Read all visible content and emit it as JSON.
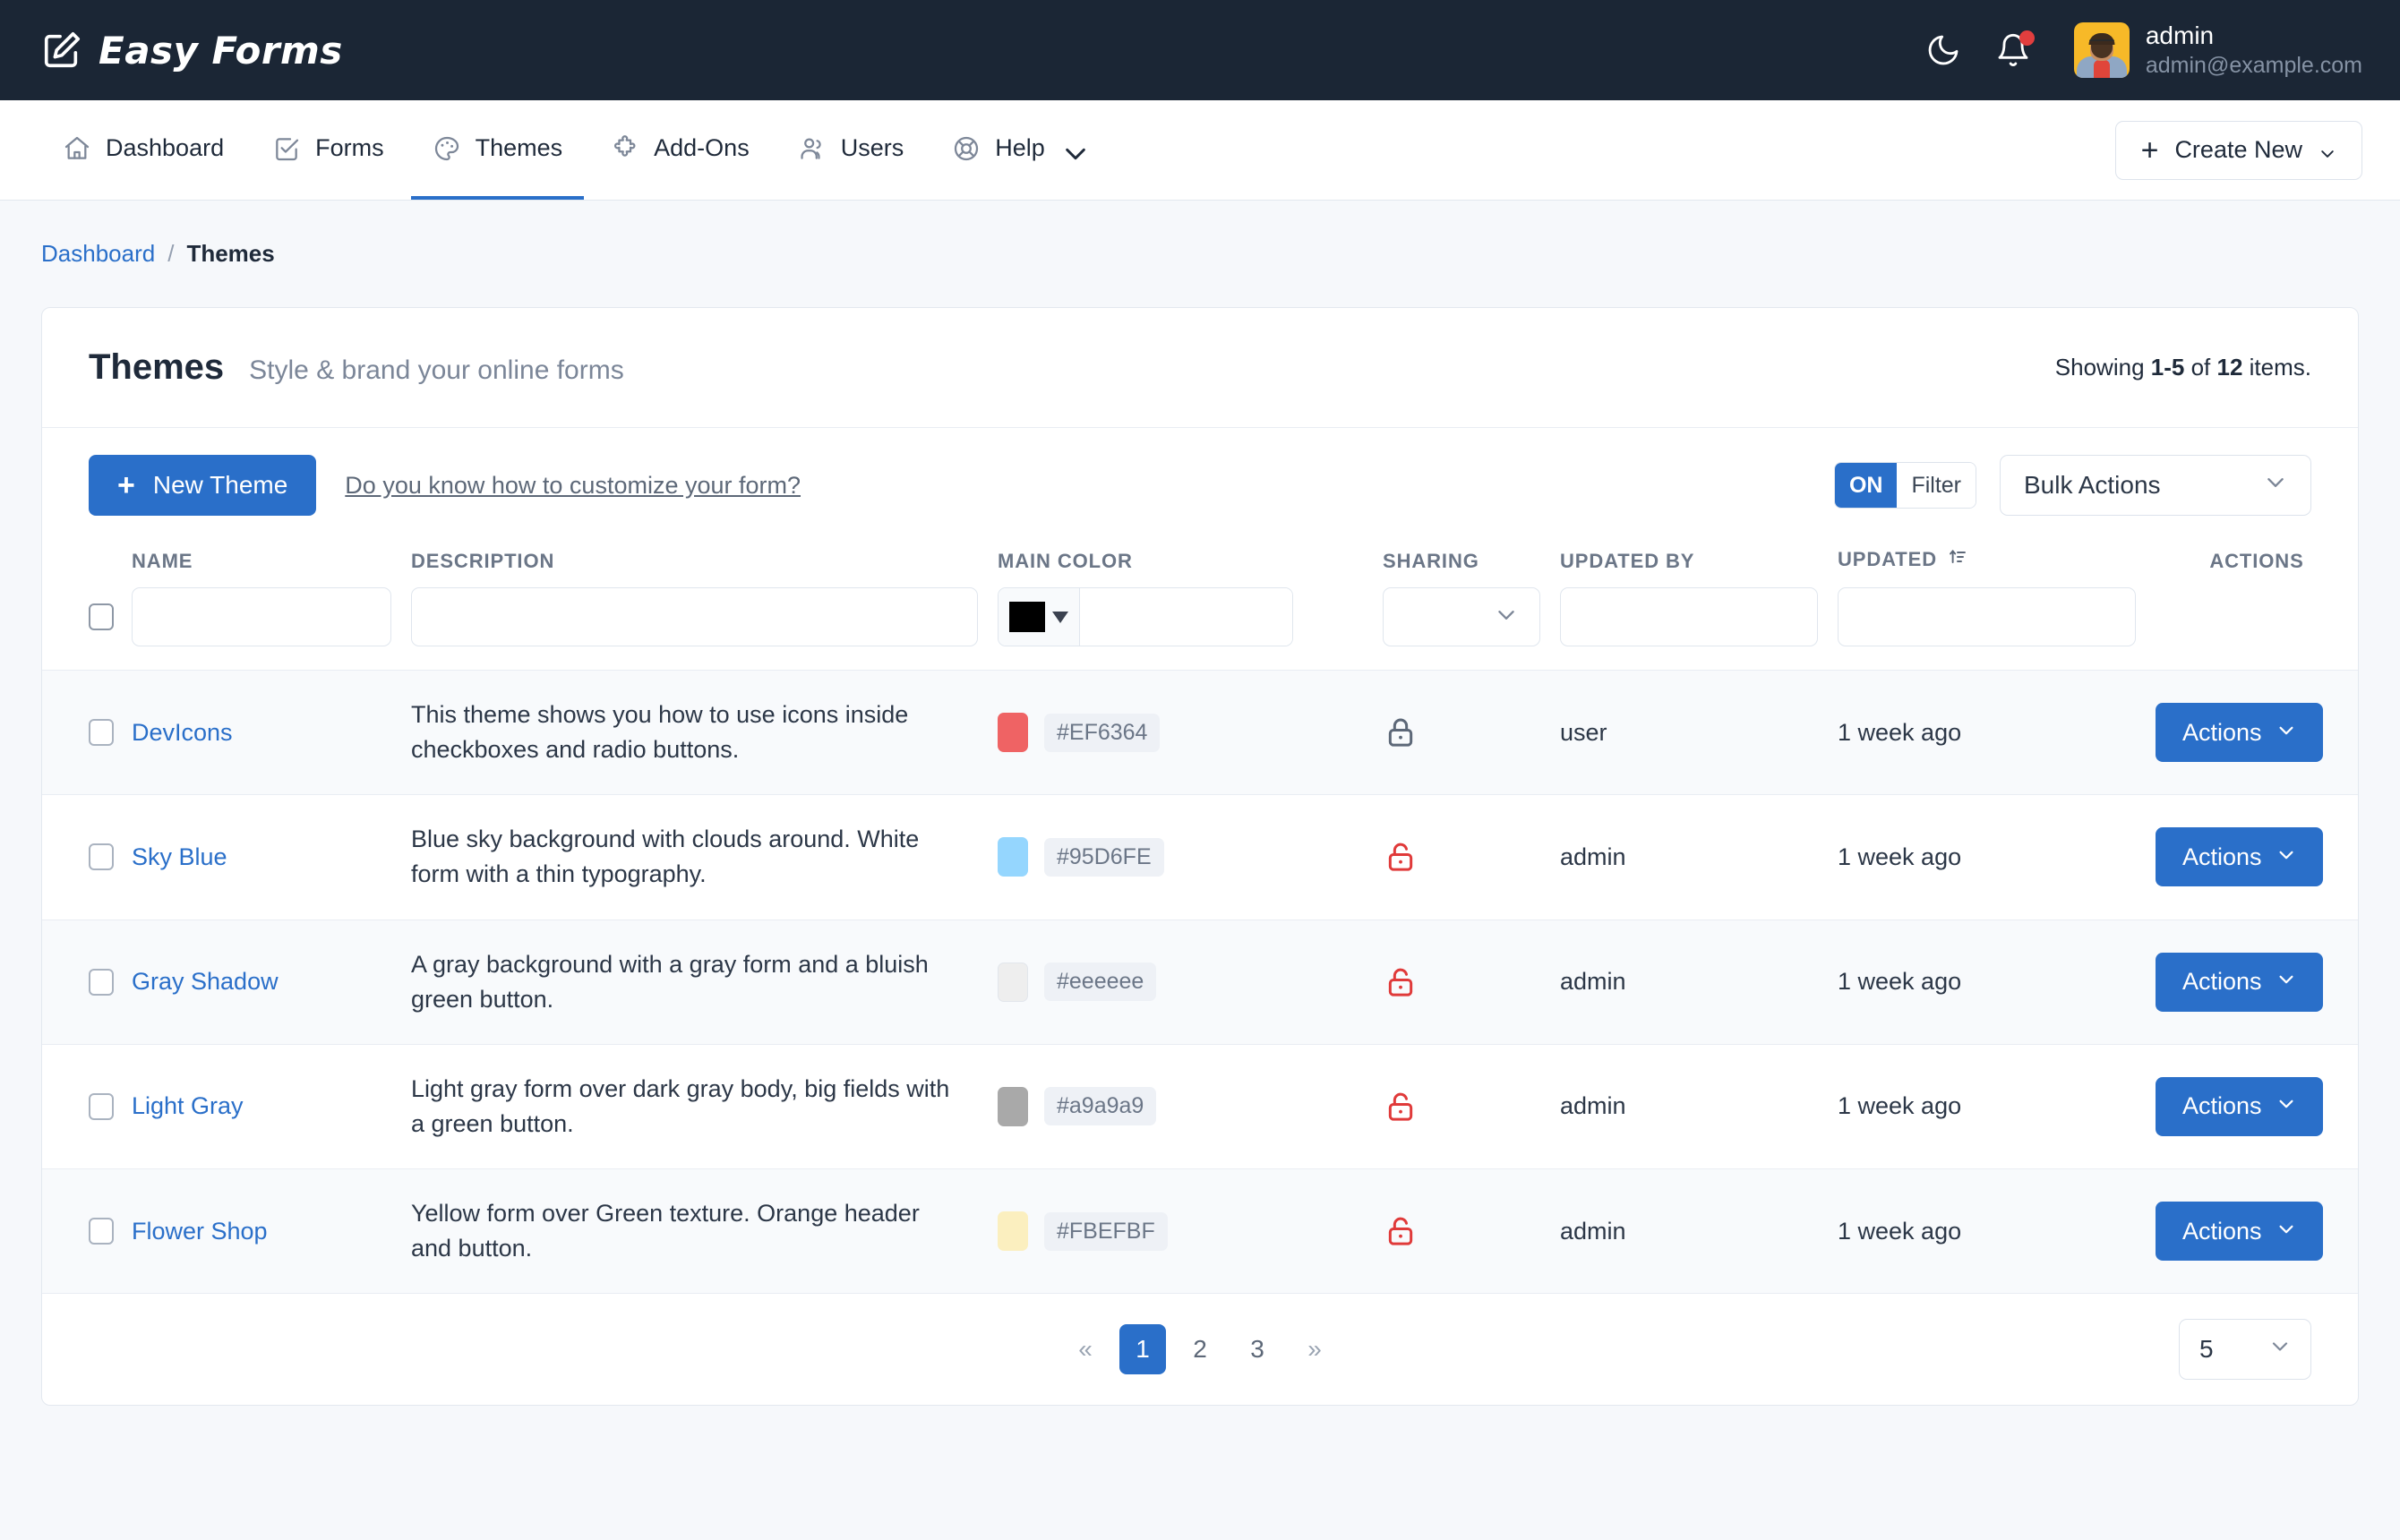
{
  "brand": {
    "name": "Easy Forms",
    "icon": "edit-square-icon"
  },
  "topbar": {
    "dark_mode_icon": "moon-icon",
    "notifications_icon": "bell-icon",
    "user": {
      "name": "admin",
      "email": "admin@example.com"
    }
  },
  "nav": {
    "items": [
      {
        "label": "Dashboard",
        "icon": "home-icon",
        "active": false
      },
      {
        "label": "Forms",
        "icon": "check-square-icon",
        "active": false
      },
      {
        "label": "Themes",
        "icon": "palette-icon",
        "active": true
      },
      {
        "label": "Add-Ons",
        "icon": "puzzle-icon",
        "active": false
      },
      {
        "label": "Users",
        "icon": "users-icon",
        "active": false
      },
      {
        "label": "Help",
        "icon": "life-ring-icon",
        "active": false,
        "caret": true
      }
    ],
    "create_new": {
      "label": "Create New",
      "icon": "plus-icon",
      "caret": "chevron-down-icon"
    }
  },
  "breadcrumb": {
    "root": "Dashboard",
    "separator": "/",
    "current": "Themes"
  },
  "card": {
    "title": "Themes",
    "subtitle": "Style & brand your online forms",
    "showing_prefix": "Showing",
    "showing_range": "1-5",
    "showing_middle": "of",
    "showing_total": "12",
    "showing_suffix": "items."
  },
  "toolbar": {
    "new_theme_label": "New Theme",
    "help_link": "Do you know how to customize your form?",
    "filter_toggle": {
      "state": "ON",
      "label": "Filter"
    },
    "bulk_actions": "Bulk Actions"
  },
  "table": {
    "headers": {
      "name": "NAME",
      "description": "DESCRIPTION",
      "main_color": "MAIN COLOR",
      "sharing": "SHARING",
      "updated_by": "UPDATED BY",
      "updated": "UPDATED",
      "actions": "ACTIONS"
    },
    "filters": {
      "name": "",
      "description": "",
      "color_swatch": "#000000",
      "color_text": "",
      "sharing": "",
      "updated_by": "",
      "updated": ""
    },
    "rows": [
      {
        "name": "DevIcons",
        "description": "This theme shows you how to use icons inside checkboxes and radio buttons.",
        "color_hex": "#EF6364",
        "sharing": "locked",
        "updated_by": "user",
        "updated": "1 week ago",
        "action_label": "Actions"
      },
      {
        "name": "Sky Blue",
        "description": "Blue sky background with clouds around. White form with a thin typography.",
        "color_hex": "#95D6FE",
        "sharing": "unlocked",
        "updated_by": "admin",
        "updated": "1 week ago",
        "action_label": "Actions"
      },
      {
        "name": "Gray Shadow",
        "description": "A gray background with a gray form and a bluish green button.",
        "color_hex": "#eeeeee",
        "sharing": "unlocked",
        "updated_by": "admin",
        "updated": "1 week ago",
        "action_label": "Actions"
      },
      {
        "name": "Light Gray",
        "description": "Light gray form over dark gray body, big fields with a green button.",
        "color_hex": "#a9a9a9",
        "sharing": "unlocked",
        "updated_by": "admin",
        "updated": "1 week ago",
        "action_label": "Actions"
      },
      {
        "name": "Flower Shop",
        "description": "Yellow form over Green texture. Orange header and button.",
        "color_hex": "#FBEFBF",
        "sharing": "unlocked",
        "updated_by": "admin",
        "updated": "1 week ago",
        "action_label": "Actions"
      }
    ]
  },
  "pagination": {
    "first": "«",
    "pages": [
      "1",
      "2",
      "3"
    ],
    "active_page": "1",
    "last": "»",
    "per_page": "5"
  },
  "colors": {
    "accent": "#2a6fc9",
    "topbar_bg": "#1b2635",
    "page_bg": "#f6f8fb",
    "locked": "#5d6878",
    "unlocked": "#e03a3a",
    "notification_dot": "#e23e3e"
  }
}
